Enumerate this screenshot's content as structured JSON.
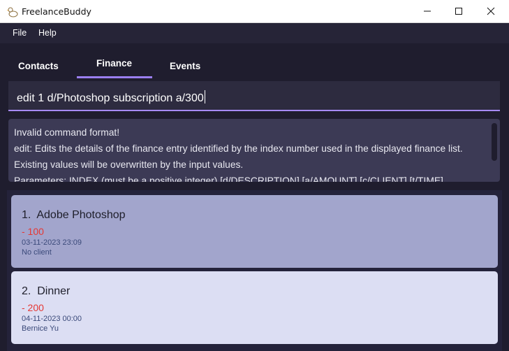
{
  "window": {
    "title": "FreelanceBuddy",
    "icons": {
      "app": "duck-icon",
      "minimize": "minimize-icon",
      "maximize": "maximize-icon",
      "close": "close-icon"
    }
  },
  "menu": {
    "file": "File",
    "help": "Help"
  },
  "tabs": [
    {
      "label": "Contacts",
      "active": false
    },
    {
      "label": "Finance",
      "active": true
    },
    {
      "label": "Events",
      "active": false
    }
  ],
  "command": {
    "value": "edit 1 d/Photoshop subscription a/300"
  },
  "result": {
    "lines": [
      "Invalid command format!",
      "edit: Edits the details of the finance entry identified by the index number used in the displayed finance list. Existing values will be overwritten by the input values.",
      "Parameters: INDEX (must be a positive integer) [d/DESCRIPTION] [a/AMOUNT] [c/CLIENT] [t/TIME]"
    ]
  },
  "finance_entries": [
    {
      "title": "1.  Adobe Photoshop",
      "amount": "- 100",
      "time": "03-11-2023 23:09",
      "client": "No client",
      "selected": true
    },
    {
      "title": "2.  Dinner",
      "amount": "- 200",
      "time": "04-11-2023 00:00",
      "client": "Bernice Yu",
      "selected": false
    }
  ],
  "colors": {
    "accent": "#a78bfa",
    "card_selected": "#a2a5cc",
    "card_normal": "#dcdef3",
    "expense": "#e53935"
  }
}
